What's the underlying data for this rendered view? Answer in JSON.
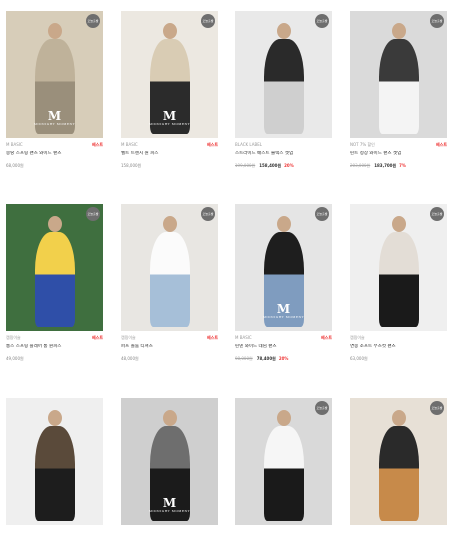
{
  "badge_text": "오늘출발",
  "logo_mark": "M",
  "logo_sub": "MIDNIGHT MOMENT",
  "products": [
    {
      "brand": "M BASIC",
      "tag": "베스트",
      "name": "몽땅 스프링 팬츠 와이드 팬츠",
      "price": "68,000원",
      "old": "",
      "sale": "",
      "pct": "",
      "colors": [
        "#d7cdb9",
        "#bfb29a",
        "#9a8f7b"
      ],
      "logo": true,
      "badge": true
    },
    {
      "brand": "M BASIC",
      "tag": "베스트",
      "name": "벨트 트렌치 원 피스",
      "price": "158,000원",
      "old": "",
      "sale": "",
      "pct": "",
      "colors": [
        "#ece8e1",
        "#d9ccb4",
        "#2b2b2b"
      ],
      "logo": true,
      "badge": true
    },
    {
      "brand": "BLACK LABEL",
      "tag": "",
      "name": "스트라이드 배스트 슬랙스 셋업",
      "price": "",
      "old": "199,000원",
      "sale": "158,400원",
      "pct": "20%",
      "colors": [
        "#e9e9e9",
        "#2a2a2a",
        "#cfcfcf"
      ],
      "logo": false,
      "badge": true
    },
    {
      "brand": "NOT 7% 할인",
      "tag": "베스트",
      "name": "린트 정장 와이드 팬츠 셋업",
      "price": "",
      "old": "203,000원",
      "sale": "183,700원",
      "pct": "7%",
      "colors": [
        "#dadada",
        "#3a3a3a",
        "#f4f4f4"
      ],
      "logo": false,
      "badge": true
    },
    {
      "brand": "캠핑이슬",
      "tag": "베스트",
      "name": "롱스 스프링 플레어 롱 원피스",
      "price": "49,000원",
      "old": "",
      "sale": "",
      "pct": "",
      "colors": [
        "#3f6f3f",
        "#f2d04b",
        "#2f4fa8"
      ],
      "logo": false,
      "badge": true
    },
    {
      "brand": "캠핑이슬",
      "tag": "베스트",
      "name": "퍼프 볼륨 티셔츠",
      "price": "48,000원",
      "old": "",
      "sale": "",
      "pct": "",
      "colors": [
        "#e8e6e2",
        "#fbfbfb",
        "#a6bfd8"
      ],
      "logo": false,
      "badge": true
    },
    {
      "brand": "M BASIC",
      "tag": "베스트",
      "name": "린넨 와이드 데님 팬츠",
      "price": "",
      "old": "98,000원",
      "sale": "78,400원",
      "pct": "20%",
      "colors": [
        "#e5e5e5",
        "#1e1e1e",
        "#7f9cbf"
      ],
      "logo": true,
      "badge": true
    },
    {
      "brand": "캠핑이슬",
      "tag": "",
      "name": "면봉 소프트 부츠컷 팬츠",
      "price": "63,000원",
      "old": "",
      "sale": "",
      "pct": "",
      "colors": [
        "#efefef",
        "#e3ddd6",
        "#1a1a1a"
      ],
      "logo": false,
      "badge": true
    },
    {
      "brand": "",
      "tag": "",
      "name": "",
      "price": "",
      "old": "",
      "sale": "",
      "pct": "",
      "colors": [
        "#efefef",
        "#5a4a3a",
        "#1d1d1d"
      ],
      "logo": false,
      "badge": false
    },
    {
      "brand": "",
      "tag": "",
      "name": "",
      "price": "",
      "old": "",
      "sale": "",
      "pct": "",
      "colors": [
        "#cfcfcf",
        "#6e6e6e",
        "#1b1b1b"
      ],
      "logo": true,
      "badge": false
    },
    {
      "brand": "",
      "tag": "",
      "name": "",
      "price": "",
      "old": "",
      "sale": "",
      "pct": "",
      "colors": [
        "#d9d9d9",
        "#f6f6f6",
        "#1a1a1a"
      ],
      "logo": false,
      "badge": true
    },
    {
      "brand": "",
      "tag": "",
      "name": "",
      "price": "",
      "old": "",
      "sale": "",
      "pct": "",
      "colors": [
        "#e7e0d6",
        "#2a2a2a",
        "#c78a4a"
      ],
      "logo": false,
      "badge": true
    }
  ]
}
